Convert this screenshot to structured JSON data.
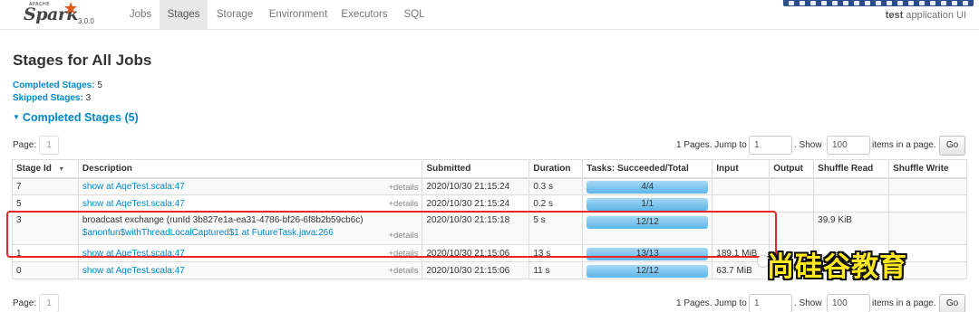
{
  "brand": {
    "apache": "APACHE",
    "name": "Spark",
    "version": "3.0.0"
  },
  "nav": {
    "tabs": [
      {
        "label": "Jobs"
      },
      {
        "label": "Stages"
      },
      {
        "label": "Storage"
      },
      {
        "label": "Environment"
      },
      {
        "label": "Executors"
      },
      {
        "label": "SQL"
      }
    ],
    "app_name": "test",
    "app_suffix": "application UI"
  },
  "page": {
    "title": "Stages for All Jobs",
    "completed_label": "Completed Stages:",
    "completed_count": "5",
    "skipped_label": "Skipped Stages:",
    "skipped_count": "3",
    "section_title": "Completed Stages (5)"
  },
  "pager": {
    "page_label": "Page:",
    "page_number": "1",
    "pages_text": "1 Pages. Jump to",
    "jump_value": "1",
    "show_label": ". Show",
    "show_value": "100",
    "items_label": "items in a page.",
    "go_label": "Go"
  },
  "table": {
    "headers": [
      "Stage Id",
      "Description",
      "Submitted",
      "Duration",
      "Tasks: Succeeded/Total",
      "Input",
      "Output",
      "Shuffle Read",
      "Shuffle Write"
    ],
    "sort_indicator": "▾",
    "details_label": "+details",
    "rows": [
      {
        "stage_id": "7",
        "desc": "show at AqeTest.scala:47",
        "desc2": "",
        "submitted": "2020/10/30 21:15:24",
        "duration": "0.3 s",
        "tasks": "4/4",
        "progress": 1.0,
        "input": "",
        "output": "",
        "shuffle_read": "",
        "shuffle_write": ""
      },
      {
        "stage_id": "5",
        "desc": "show at AqeTest.scala:47",
        "desc2": "",
        "submitted": "2020/10/30 21:15:24",
        "duration": "0.2 s",
        "tasks": "1/1",
        "progress": 1.0,
        "input": "",
        "output": "",
        "shuffle_read": "",
        "shuffle_write": ""
      },
      {
        "stage_id": "3",
        "desc": "broadcast exchange (runId 3b827e1a-ea31-4786-bf26-6f8b2b59cb6c)",
        "desc2": "$anonfun$withThreadLocalCaptured$1 at FutureTask.java:266",
        "submitted": "2020/10/30 21:15:18",
        "duration": "5 s",
        "tasks": "12/12",
        "progress": 1.0,
        "input": "",
        "output": "",
        "shuffle_read": "39.9 KiB",
        "shuffle_write": ""
      },
      {
        "stage_id": "1",
        "desc": "show at AqeTest.scala:47",
        "desc2": "",
        "submitted": "2020/10/30 21:15:06",
        "duration": "13 s",
        "tasks": "13/13",
        "progress": 1.0,
        "input": "189.1 MiB",
        "output": "",
        "shuffle_read": "",
        "shuffle_write": ""
      },
      {
        "stage_id": "0",
        "desc": "show at AqeTest.scala:47",
        "desc2": "",
        "submitted": "2020/10/30 21:15:06",
        "duration": "11 s",
        "tasks": "12/12",
        "progress": 1.0,
        "input": "63.7 MiB",
        "output": "",
        "shuffle_read": "",
        "shuffle_write": ""
      }
    ]
  },
  "watermark": "尚硅谷教育",
  "colors": {
    "link": "#0088cc",
    "progress": "#5bb6ea",
    "highlight": "#e8262a",
    "watermark": "#ffe81f"
  }
}
